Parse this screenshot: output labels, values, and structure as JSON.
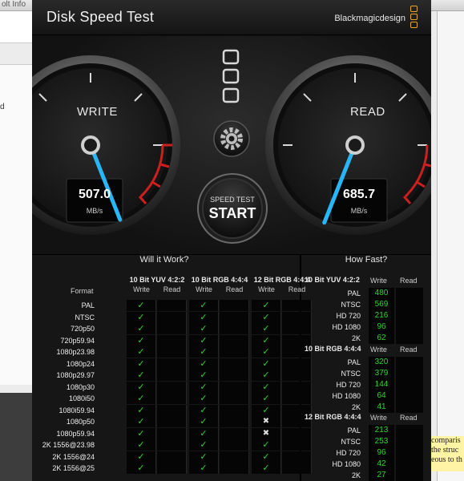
{
  "background": {
    "window_title": "olt Info",
    "left_mark": "d",
    "note_lines": [
      "comparis",
      "the struc",
      "eous to th"
    ]
  },
  "app": {
    "title": "Disk Speed Test",
    "brand": "Blackmagicdesign",
    "accent": "#e8a628"
  },
  "write_gauge": {
    "label": "WRITE",
    "value": "507.0",
    "unit": "MB/s",
    "level": 0.42
  },
  "read_gauge": {
    "label": "READ",
    "value": "685.7",
    "unit": "MB/s",
    "level": 0.58
  },
  "start_button": {
    "caption": "SPEED TEST",
    "label": "START"
  },
  "will_it_work": {
    "title": "Will it Work?",
    "format_header": "Format",
    "groups": [
      "10 Bit YUV 4:2:2",
      "10 Bit RGB 4:4:4",
      "12 Bit RGB 4:4:4"
    ],
    "sub_headers": [
      "Write",
      "Read",
      "Write",
      "Read",
      "Write",
      "Read"
    ],
    "rows": [
      {
        "format": "PAL",
        "cells": [
          "check",
          "",
          "check",
          "",
          "check",
          ""
        ]
      },
      {
        "format": "NTSC",
        "cells": [
          "check",
          "",
          "check",
          "",
          "check",
          ""
        ]
      },
      {
        "format": "720p50",
        "cells": [
          "check",
          "",
          "check",
          "",
          "check",
          ""
        ]
      },
      {
        "format": "720p59.94",
        "cells": [
          "check",
          "",
          "check",
          "",
          "check",
          ""
        ]
      },
      {
        "format": "1080p23.98",
        "cells": [
          "check",
          "",
          "check",
          "",
          "check",
          ""
        ]
      },
      {
        "format": "1080p24",
        "cells": [
          "check",
          "",
          "check",
          "",
          "check",
          ""
        ]
      },
      {
        "format": "1080p29.97",
        "cells": [
          "check",
          "",
          "check",
          "",
          "check",
          ""
        ]
      },
      {
        "format": "1080p30",
        "cells": [
          "check",
          "",
          "check",
          "",
          "check",
          ""
        ]
      },
      {
        "format": "1080i50",
        "cells": [
          "check",
          "",
          "check",
          "",
          "check",
          ""
        ]
      },
      {
        "format": "1080i59.94",
        "cells": [
          "check",
          "",
          "check",
          "",
          "check",
          ""
        ]
      },
      {
        "format": "1080p50",
        "cells": [
          "check",
          "",
          "check",
          "",
          "cross",
          ""
        ]
      },
      {
        "format": "1080p59.94",
        "cells": [
          "check",
          "",
          "check",
          "",
          "cross",
          ""
        ]
      },
      {
        "format": "2K 1556@23.98",
        "cells": [
          "check",
          "",
          "check",
          "",
          "check",
          ""
        ]
      },
      {
        "format": "2K 1556@24",
        "cells": [
          "check",
          "",
          "check",
          "",
          "check",
          ""
        ]
      },
      {
        "format": "2K 1556@25",
        "cells": [
          "check",
          "",
          "check",
          "",
          "check",
          ""
        ]
      }
    ]
  },
  "how_fast": {
    "title": "How Fast?",
    "write_header": "Write",
    "read_header": "Read",
    "groups": [
      {
        "name": "10 Bit YUV 4:2:2",
        "rows": [
          {
            "label": "PAL",
            "write": "480"
          },
          {
            "label": "NTSC",
            "write": "569"
          },
          {
            "label": "HD 720",
            "write": "216"
          },
          {
            "label": "HD 1080",
            "write": "96"
          },
          {
            "label": "2K",
            "write": "62"
          }
        ]
      },
      {
        "name": "10 Bit RGB 4:4:4",
        "rows": [
          {
            "label": "PAL",
            "write": "320"
          },
          {
            "label": "NTSC",
            "write": "379"
          },
          {
            "label": "HD 720",
            "write": "144"
          },
          {
            "label": "HD 1080",
            "write": "64"
          },
          {
            "label": "2K",
            "write": "41"
          }
        ]
      },
      {
        "name": "12 Bit RGB 4:4:4",
        "rows": [
          {
            "label": "PAL",
            "write": "213"
          },
          {
            "label": "NTSC",
            "write": "253"
          },
          {
            "label": "HD 720",
            "write": "96"
          },
          {
            "label": "HD 1080",
            "write": "42"
          },
          {
            "label": "2K",
            "write": "27"
          }
        ]
      }
    ]
  }
}
